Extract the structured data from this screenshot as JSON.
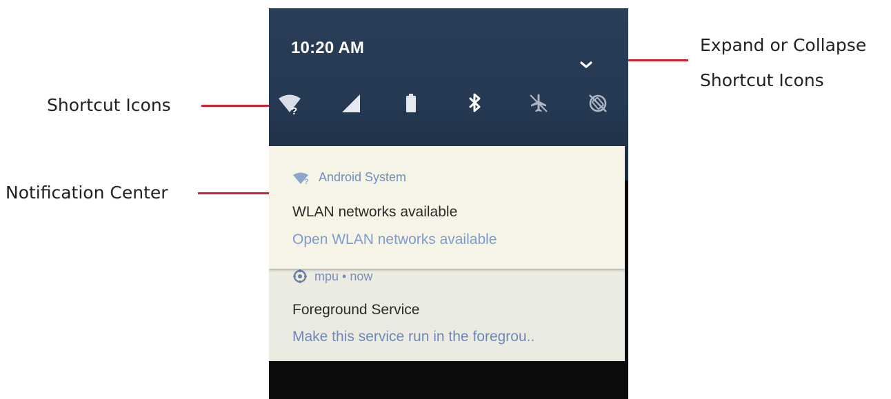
{
  "annotations": {
    "expand_collapse_line1": "Expand or Collapse",
    "expand_collapse_line2": "Shortcut Icons",
    "shortcut_icons": "Shortcut Icons",
    "notification_center": "Notification Center",
    "line_color": "#d2202f"
  },
  "status_bar": {
    "time": "10:20 AM"
  },
  "quick_settings": {
    "expand_icon": "chevron-down-icon",
    "tiles": [
      {
        "icon": "wifi-unknown-icon"
      },
      {
        "icon": "cellular-signal-icon"
      },
      {
        "icon": "battery-icon"
      },
      {
        "icon": "bluetooth-icon"
      },
      {
        "icon": "airplane-mode-off-icon"
      },
      {
        "icon": "auto-rotate-off-icon"
      }
    ]
  },
  "notifications": [
    {
      "icon": "wifi-unknown-icon",
      "app": "Android System",
      "title": "WLAN networks available",
      "body": "Open WLAN networks available"
    },
    {
      "icon": "app-icon",
      "app": "mpu • now",
      "title": "Foreground Service",
      "body": "Make this service run in the foregrou.."
    }
  ],
  "colors": {
    "shade_bg": "#253953",
    "card_bg": "#f5f4e6",
    "accent_text": "#7a9ccf"
  }
}
